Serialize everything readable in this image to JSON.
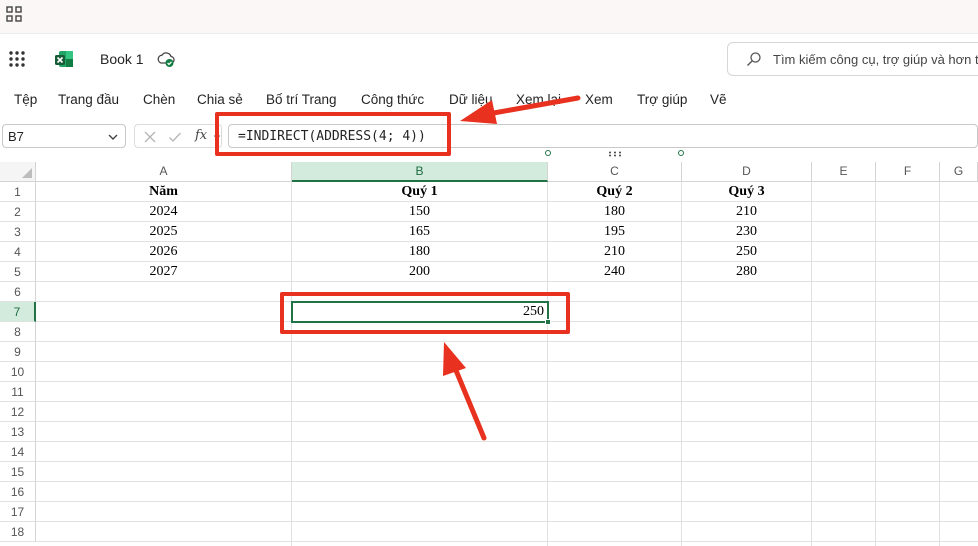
{
  "app": {
    "book_title": "Book 1",
    "search_placeholder": "Tìm kiếm công cụ, trợ giúp và hơn thế nữa"
  },
  "ribbon": {
    "tabs": [
      "Tệp",
      "Trang đầu",
      "Chèn",
      "Chia sẻ",
      "Bố trí Trang",
      "Công thức",
      "Dữ liệu",
      "Xem lại",
      "Xem",
      "Trợ giúp",
      "Vẽ"
    ]
  },
  "formula_bar": {
    "name_box": "B7",
    "fx_label": "fx",
    "formula": "=INDIRECT(ADDRESS(4; 4))"
  },
  "sheet": {
    "columns": [
      "A",
      "B",
      "C",
      "D",
      "E",
      "F",
      "G"
    ],
    "rows": [
      "1",
      "2",
      "3",
      "4",
      "5",
      "6",
      "7",
      "8",
      "9",
      "10",
      "11",
      "12",
      "13",
      "14",
      "15",
      "16",
      "17",
      "18"
    ],
    "selected_column": "B",
    "selected_row": "7",
    "header_row": [
      "Năm",
      "Quý 1",
      "Quý 2",
      "Quý 3"
    ],
    "data_rows": [
      [
        "2024",
        "150",
        "180",
        "210"
      ],
      [
        "2025",
        "165",
        "195",
        "230"
      ],
      [
        "2026",
        "180",
        "210",
        "250"
      ],
      [
        "2027",
        "200",
        "240",
        "280"
      ]
    ],
    "active_cell_value": "250"
  },
  "colors": {
    "accent": "#217346",
    "annotation": "#e8321f"
  },
  "icons": [
    "apps-grid-icon",
    "app-launcher-icon",
    "excel-logo-icon",
    "cloud-sync-icon",
    "search-icon",
    "chevron-down-icon",
    "cancel-x-icon",
    "checkmark-icon"
  ]
}
